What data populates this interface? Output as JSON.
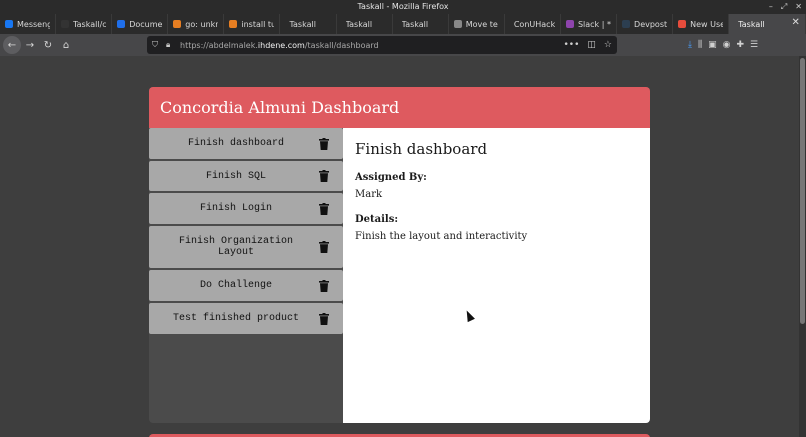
{
  "window": {
    "title": "Taskall - Mozilla Firefox"
  },
  "tabs": [
    {
      "label": "Messenger",
      "fav_color": "#1877f2",
      "width": 56
    },
    {
      "label": "Taskall/c",
      "fav_color": "#333333",
      "width": 56
    },
    {
      "label": "Document",
      "fav_color": "#1f6feb",
      "width": 56
    },
    {
      "label": "go: unkn",
      "fav_color": "#e67e22",
      "width": 56
    },
    {
      "label": "install tu",
      "fav_color": "#e67e22",
      "width": 56
    },
    {
      "label": "Taskall",
      "fav_color": "",
      "width": 56
    },
    {
      "label": "Taskall",
      "fav_color": "",
      "width": 56
    },
    {
      "label": "Taskall",
      "fav_color": "",
      "width": 56
    },
    {
      "label": "Move te",
      "fav_color": "#888888",
      "width": 56
    },
    {
      "label": "ConUHacks",
      "fav_color": "",
      "width": 56
    },
    {
      "label": "Slack | *",
      "fav_color": "#8e44ad",
      "width": 56
    },
    {
      "label": "Devpost",
      "fav_color": "#2c3e50",
      "width": 56
    },
    {
      "label": "New Use",
      "fav_color": "#e74c3c",
      "width": 56
    },
    {
      "label": "Taskall",
      "fav_color": "",
      "width": 60,
      "active": true
    }
  ],
  "nav": {
    "url_prefix": "https://abdelmalek.",
    "url_domain": "ihdene.com",
    "url_path": "/taskall/dashboard"
  },
  "dashboard": {
    "title": "Concordia Almuni Dashboard",
    "tasks": [
      {
        "label": "Finish dashboard",
        "height": 31
      },
      {
        "label": "Finish SQL",
        "height": 30
      },
      {
        "label": "Finish Login",
        "height": 31
      },
      {
        "label": "Finish Organization Layout",
        "height": 42
      },
      {
        "label": "Do Challenge",
        "height": 31
      },
      {
        "label": "Test finished product",
        "height": 31
      }
    ],
    "detail": {
      "title": "Finish dashboard",
      "assigned_label": "Assigned By:",
      "assigned_value": "Mark",
      "details_label": "Details:",
      "details_value": "Finish the layout and interactivity"
    }
  },
  "colors": {
    "accent": "#de5a5f",
    "item_bg": "#a8a8a8",
    "panel_bg": "#4b4b4b"
  }
}
